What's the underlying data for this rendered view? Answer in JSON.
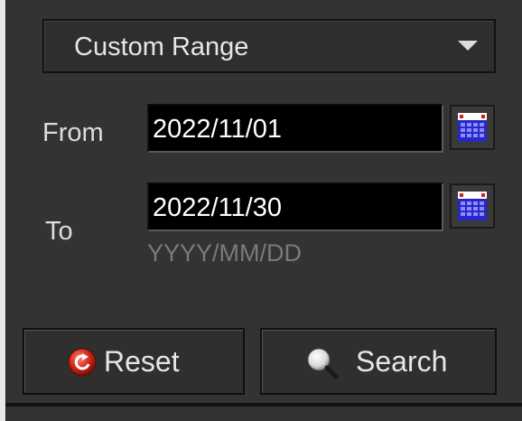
{
  "range_select": {
    "value": "Custom Range"
  },
  "from": {
    "label": "From",
    "value": "2022/11/01"
  },
  "to": {
    "label": "To",
    "value": "2022/11/30"
  },
  "date_hint": "YYYY/MM/DD",
  "buttons": {
    "reset": "Reset",
    "search": "Search"
  },
  "icons": {
    "calendar": "calendar-icon",
    "reset": "reset-icon",
    "search": "search-icon",
    "dropdown": "chevron-down-icon"
  },
  "colors": {
    "panel_bg": "#333333",
    "input_bg": "#000000",
    "text": "#e6e6e6",
    "hint": "#7a7a7a",
    "calendar_blue": "#3b3bd8",
    "reset_red": "#cc2222"
  }
}
